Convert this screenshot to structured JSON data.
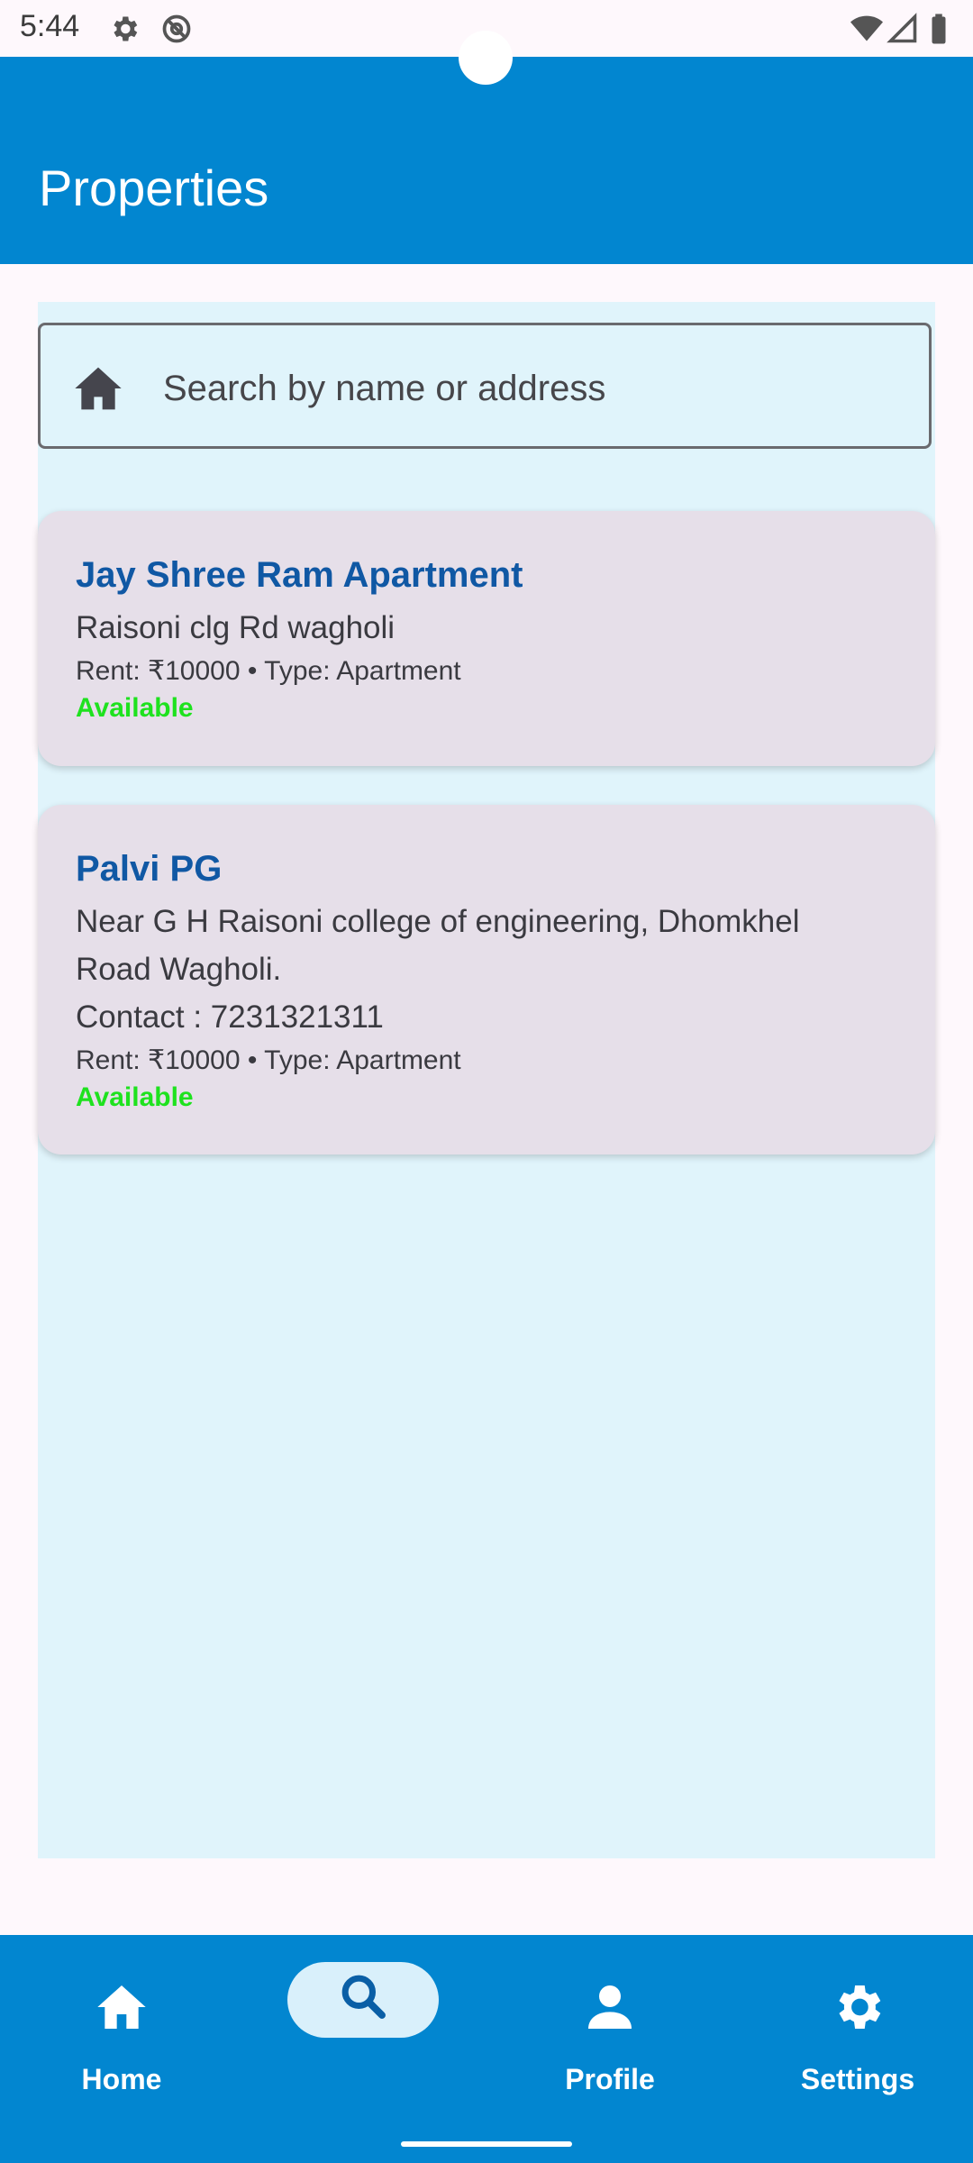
{
  "status_bar": {
    "time": "5:44"
  },
  "app_bar": {
    "title": "Properties"
  },
  "search": {
    "placeholder": "Search by name or address",
    "icon": "home-icon"
  },
  "properties": [
    {
      "name": "Jay Shree Ram Apartment",
      "address": "Raisoni clg Rd wagholi",
      "meta": "Rent: ₹10000 • Type: Apartment",
      "status": "Available"
    },
    {
      "name": "Palvi PG",
      "address_line1": "Near G H Raisoni college of engineering, Dhomkhel",
      "address_line2": "Road Wagholi.",
      "contact": "Contact : 7231321311",
      "meta": "Rent: ₹10000 • Type: Apartment",
      "status": "Available"
    }
  ],
  "bottom_nav": {
    "items": [
      {
        "label": "Home",
        "icon": "home-icon"
      },
      {
        "label": "",
        "icon": "search-icon",
        "selected": true
      },
      {
        "label": "Profile",
        "icon": "person-icon"
      },
      {
        "label": "Settings",
        "icon": "gear-icon"
      }
    ]
  },
  "colors": {
    "primary": "#0286d0",
    "content_bg": "#e0f4fb",
    "card_bg": "#e6dfe9",
    "title": "#1058a4",
    "available": "#1ee21e"
  }
}
